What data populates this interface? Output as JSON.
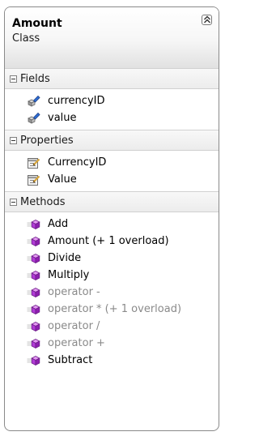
{
  "class": {
    "name": "Amount",
    "stereotype": "Class",
    "collapse_icon": "double-chevron-up-icon"
  },
  "sections": {
    "fields": {
      "title": "Fields",
      "items": [
        {
          "label": "currencyID",
          "icon": "field-icon",
          "dim": false
        },
        {
          "label": "value",
          "icon": "field-icon",
          "dim": false
        }
      ]
    },
    "properties": {
      "title": "Properties",
      "items": [
        {
          "label": "CurrencyID",
          "icon": "property-icon",
          "dim": false
        },
        {
          "label": "Value",
          "icon": "property-icon",
          "dim": false
        }
      ]
    },
    "methods": {
      "title": "Methods",
      "items": [
        {
          "label": "Add",
          "icon": "method-icon",
          "dim": false
        },
        {
          "label": "Amount (+ 1 overload)",
          "icon": "method-icon",
          "dim": false
        },
        {
          "label": "Divide",
          "icon": "method-icon",
          "dim": false
        },
        {
          "label": "Multiply",
          "icon": "method-icon",
          "dim": false
        },
        {
          "label": "operator -",
          "icon": "method-icon",
          "dim": true
        },
        {
          "label": "operator * (+ 1 overload)",
          "icon": "method-icon",
          "dim": true
        },
        {
          "label": "operator /",
          "icon": "method-icon",
          "dim": true
        },
        {
          "label": "operator +",
          "icon": "method-icon",
          "dim": true
        },
        {
          "label": "Subtract",
          "icon": "method-icon",
          "dim": false
        }
      ]
    }
  },
  "colors": {
    "field_blue": "#2f6fd6",
    "method_purple": "#b13bd6",
    "property_gold": "#d9a63a"
  }
}
